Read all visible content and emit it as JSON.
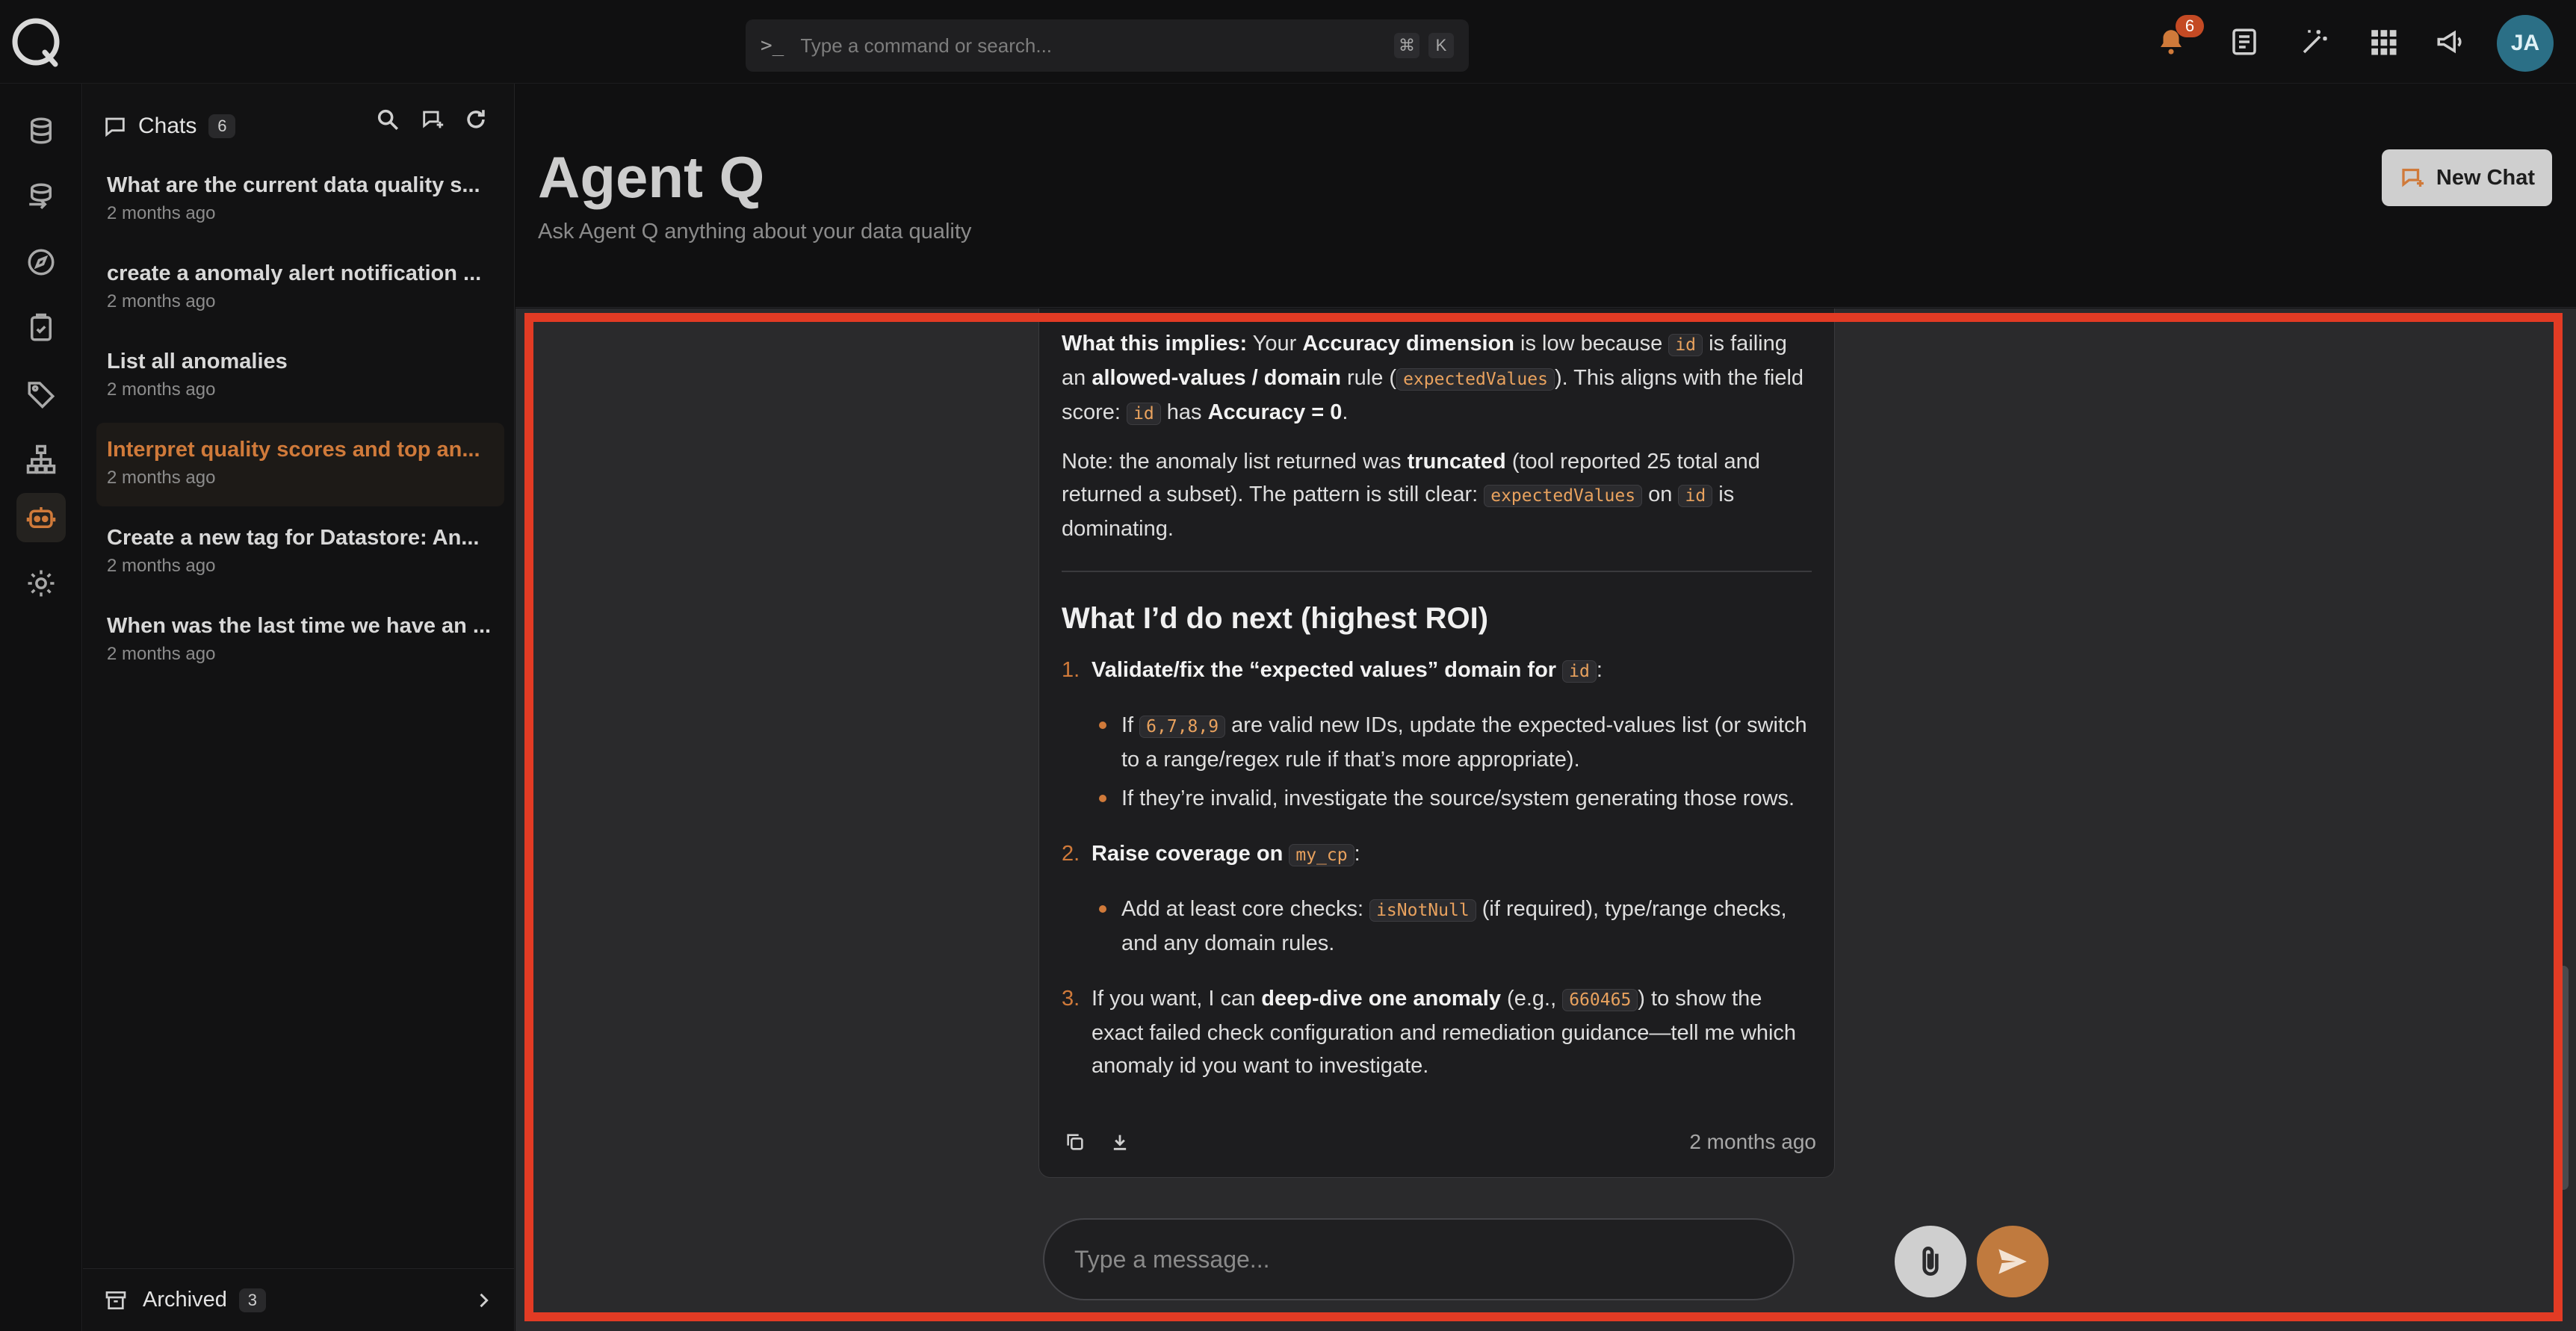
{
  "topbar": {
    "command_placeholder": "Type a command or search...",
    "shortcut_mod": "⌘",
    "shortcut_key": "K",
    "notification_count": "6",
    "avatar_initials": "JA"
  },
  "sidebar": {
    "title": "Chats",
    "count": "6",
    "chats": [
      {
        "title": "What are the current data quality s...",
        "date": "2 months ago"
      },
      {
        "title": "create a anomaly alert notification ...",
        "date": "2 months ago"
      },
      {
        "title": "List all anomalies",
        "date": "2 months ago"
      },
      {
        "title": "Interpret quality scores and top an...",
        "date": "2 months ago"
      },
      {
        "title": "Create a new tag for Datastore: An...",
        "date": "2 months ago"
      },
      {
        "title": "When was the last time we have an ...",
        "date": "2 months ago"
      }
    ],
    "archived_label": "Archived",
    "archived_count": "3"
  },
  "header": {
    "title": "Agent Q",
    "subtitle": "Ask Agent Q anything about your data quality",
    "new_chat_label": "New Chat"
  },
  "message": {
    "p1_a": "What this implies:",
    "p1_b": " Your ",
    "p1_c": "Accuracy dimension",
    "p1_d": " is low because ",
    "p1_code1": "id",
    "p1_e": " is failing an ",
    "p1_f": "allowed-values / domain",
    "p1_g": " rule (",
    "p1_code2": "expectedValues",
    "p1_h": "). This aligns with the field score: ",
    "p1_code3": "id",
    "p1_i": " has ",
    "p1_j": "Accuracy = 0",
    "p1_k": ".",
    "p2_a": "Note: the anomaly list returned was ",
    "p2_b": "truncated",
    "p2_c": " (tool reported 25 total and returned a subset). The pattern is still clear: ",
    "p2_code1": "expectedValues",
    "p2_d": " on ",
    "p2_code2": "id",
    "p2_e": " is dominating.",
    "heading": "What I’d do next (highest ROI)",
    "s1_num": "1.",
    "s1_a": "Validate/fix the “expected values” domain for ",
    "s1_code": "id",
    "s1_b": ":",
    "s1_b1_a": "If ",
    "s1_b1_code": "6,7,8,9",
    "s1_b1_b": " are valid new IDs, update the expected-values list (or switch to a range/regex rule if that’s more appropriate).",
    "s1_b2": "If they’re invalid, investigate the source/system generating those rows.",
    "s2_num": "2.",
    "s2_a": "Raise coverage on ",
    "s2_code": "my_cp",
    "s2_b": ":",
    "s2_b1_a": "Add at least core checks: ",
    "s2_b1_code": "isNotNull",
    "s2_b1_b": " (if required), type/range checks, and any domain rules.",
    "s3_num": "3.",
    "s3_a": "If you want, I can ",
    "s3_b": "deep-dive one anomaly",
    "s3_c": " (e.g., ",
    "s3_code": "660465",
    "s3_d": ") to show the exact failed check configuration and remediation guidance—tell me which anomaly id you want to investigate.",
    "timestamp": "2 months ago"
  },
  "composer": {
    "placeholder": "Type a message..."
  },
  "colors": {
    "accent": "#d07a3a",
    "highlight_border": "#e23b24",
    "badge": "#c44a24",
    "avatar": "#2b6f86"
  }
}
